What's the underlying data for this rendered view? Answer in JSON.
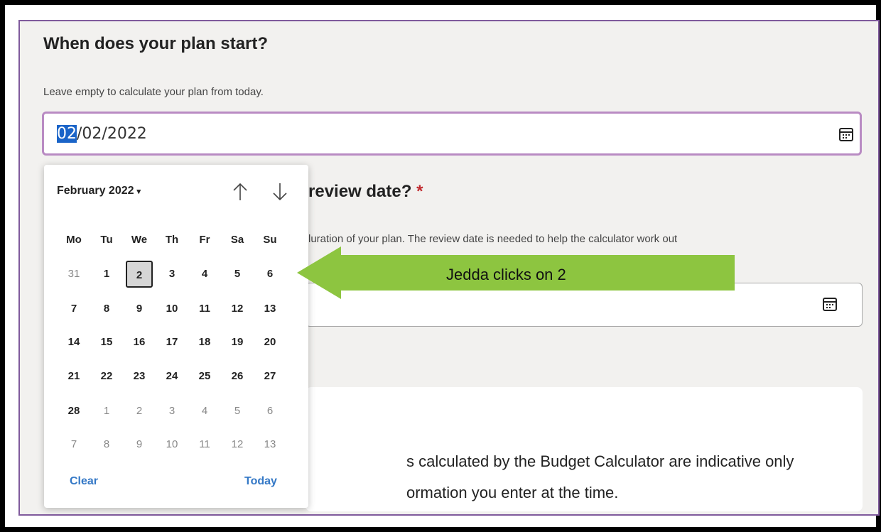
{
  "plan_start": {
    "question": "When does your plan start?",
    "hint": "Leave empty to calculate your plan from today.",
    "value_selected_part": "02",
    "value_rest": "/02/2022",
    "icon": "calendar-icon"
  },
  "review": {
    "question_visible": "review date?",
    "required_mark": "*",
    "hint_visible": "luration of your plan. The review date is needed to help the calculator work out",
    "icon": "calendar-icon"
  },
  "info_card": {
    "line1": "s calculated by the Budget Calculator are indicative only",
    "line2": "ormation you enter at the time."
  },
  "datepicker": {
    "month_label": "February 2022",
    "caret": "▾",
    "nav_up_icon": "arrow-up-icon",
    "nav_down_icon": "arrow-down-icon",
    "weekdays": [
      "Mo",
      "Tu",
      "We",
      "Th",
      "Fr",
      "Sa",
      "Su"
    ],
    "weeks": [
      [
        "31",
        "1",
        "2",
        "3",
        "4",
        "5",
        "6"
      ],
      [
        "7",
        "8",
        "9",
        "10",
        "11",
        "12",
        "13"
      ],
      [
        "14",
        "15",
        "16",
        "17",
        "18",
        "19",
        "20"
      ],
      [
        "21",
        "22",
        "23",
        "24",
        "25",
        "26",
        "27"
      ],
      [
        "28",
        "1",
        "2",
        "3",
        "4",
        "5",
        "6"
      ],
      [
        "7",
        "8",
        "9",
        "10",
        "11",
        "12",
        "13"
      ]
    ],
    "other_month_cells": [
      [
        0,
        0
      ],
      [
        4,
        1
      ],
      [
        4,
        2
      ],
      [
        4,
        3
      ],
      [
        4,
        4
      ],
      [
        4,
        5
      ],
      [
        4,
        6
      ],
      [
        5,
        0
      ],
      [
        5,
        1
      ],
      [
        5,
        2
      ],
      [
        5,
        3
      ],
      [
        5,
        4
      ],
      [
        5,
        5
      ],
      [
        5,
        6
      ]
    ],
    "selected_cell": [
      0,
      2
    ],
    "clear_label": "Clear",
    "today_label": "Today"
  },
  "annotation": {
    "text": "Jedda clicks on 2",
    "color": "#8dc540"
  }
}
